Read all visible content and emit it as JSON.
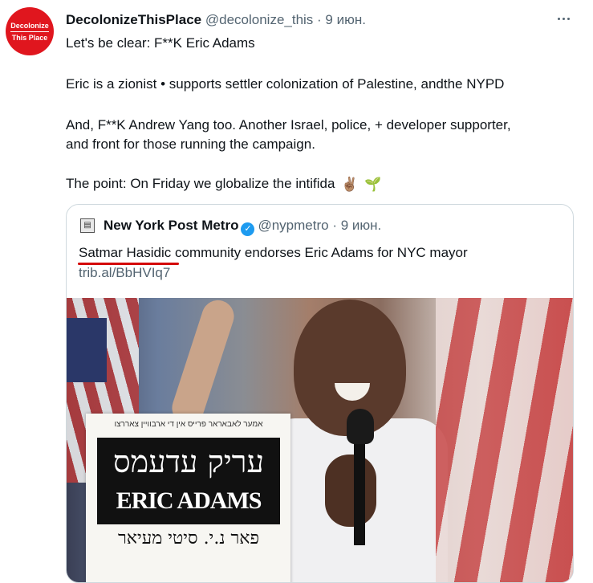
{
  "tweet": {
    "avatar": {
      "line1": "Decolonize",
      "line2": "This Place",
      "color": "#e0161e"
    },
    "author_name": "DecolonizeThisPlace",
    "handle": "@decolonize_this",
    "separator": " · ",
    "date": "9 июн.",
    "more_icon": "more-horizontal-icon",
    "lines": [
      "Let's be clear: F**K Eric Adams",
      "Eric is a zionist • supports settler colonization of Palestine, andthe NYPD",
      "And, F**K Andrew Yang too. Another Israel, police, + developer supporter,",
      "and front for those running the campaign.",
      "The point: On Friday we globalize the intifida"
    ],
    "emojis": [
      "✌🏽",
      "🌱"
    ]
  },
  "quote": {
    "source_icon": "newspaper-icon",
    "author_name": "New York Post Metro",
    "verified_icon": "verified-badge-icon",
    "handle": "@nypmetro",
    "separator": " · ",
    "date": "9 июн.",
    "text_underlined": "Satmar Hasidic",
    "text_rest": " community endorses Eric Adams for NYC mayor",
    "link": "trib.al/BbHVIq7",
    "underline_color": "#d40000"
  },
  "photo": {
    "paper_top": "אמער לאבאראר פרייס אין די ארבוויין צאררצו",
    "paper_headline_hebrew": "עריק עדעמס",
    "paper_headline_english": "ERIC ADAMS",
    "paper_bottom": "פאר נ.י. סיטי מעיאר"
  }
}
